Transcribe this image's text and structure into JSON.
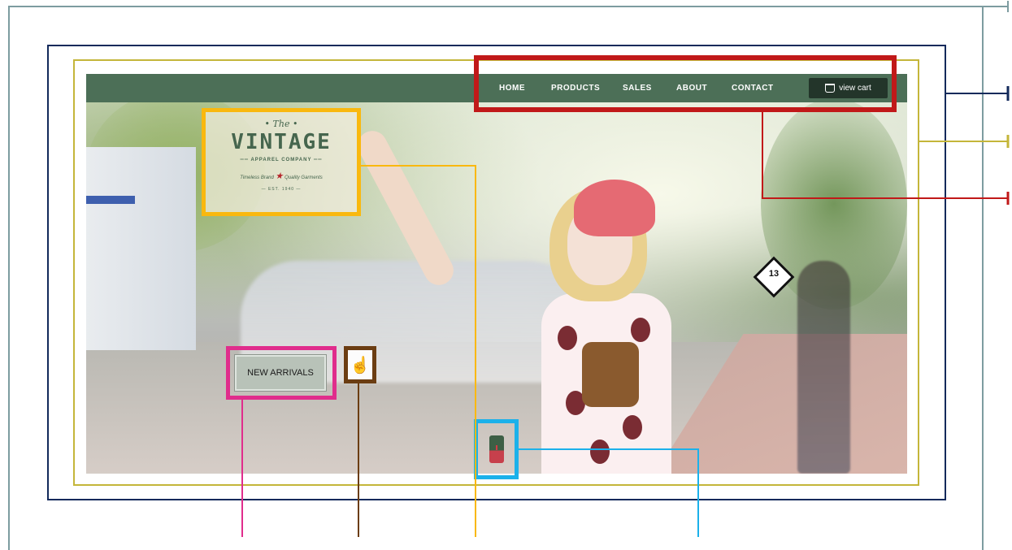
{
  "nav": {
    "items": [
      {
        "label": "HOME"
      },
      {
        "label": "PRODUCTS"
      },
      {
        "label": "SALES"
      },
      {
        "label": "ABOUT"
      },
      {
        "label": "CONTACT"
      }
    ],
    "cart_label": "view cart"
  },
  "logo": {
    "the": "• The •",
    "main": "VINTAGE",
    "sub": "APPAREL COMPANY",
    "tagline_left": "Timeless Brand",
    "tagline_right": "Quality Garments",
    "est": "— EST. 1940 —"
  },
  "hero": {
    "cta_label": "NEW ARRIVALS",
    "sign_text": "13"
  },
  "icons": {
    "hand": "hand-pointer-icon",
    "flag": "flag-icon",
    "cart": "basket-icon"
  },
  "colors": {
    "nav_bg": "#4c6f57",
    "cart_bg": "#23352a",
    "frame_nav": "#c11919",
    "frame_logo": "#f9b80f",
    "frame_button": "#e02d8c",
    "frame_hand": "#6b3d12",
    "frame_flag": "#1bb1ea",
    "frame_page": "#132a5b",
    "frame_content": "#c4b63a",
    "frame_outer": "#7d9ca0"
  }
}
